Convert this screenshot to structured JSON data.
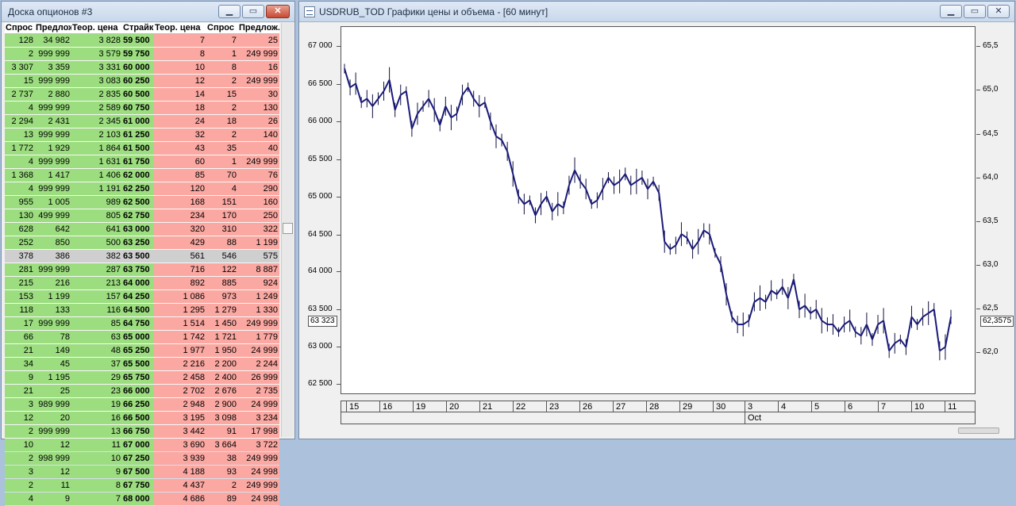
{
  "board": {
    "title": "Доска опционов #3",
    "headers": [
      "Спрос",
      "Предлож.",
      "Теор. цена",
      "Страйк",
      "Теор. цена",
      "Спрос",
      "Предлож."
    ],
    "rows": [
      [
        "128",
        "34 982",
        "3 828",
        "59 500",
        "7",
        "7",
        "25"
      ],
      [
        "2",
        "999 999",
        "3 579",
        "59 750",
        "8",
        "1",
        "249 999"
      ],
      [
        "3 307",
        "3 359",
        "3 331",
        "60 000",
        "10",
        "8",
        "16"
      ],
      [
        "15",
        "999 999",
        "3 083",
        "60 250",
        "12",
        "2",
        "249 999"
      ],
      [
        "2 737",
        "2 880",
        "2 835",
        "60 500",
        "14",
        "15",
        "30"
      ],
      [
        "4",
        "999 999",
        "2 589",
        "60 750",
        "18",
        "2",
        "130"
      ],
      [
        "2 294",
        "2 431",
        "2 345",
        "61 000",
        "24",
        "18",
        "26"
      ],
      [
        "13",
        "999 999",
        "2 103",
        "61 250",
        "32",
        "2",
        "140"
      ],
      [
        "1 772",
        "1 929",
        "1 864",
        "61 500",
        "43",
        "35",
        "40"
      ],
      [
        "4",
        "999 999",
        "1 631",
        "61 750",
        "60",
        "1",
        "249 999"
      ],
      [
        "1 368",
        "1 417",
        "1 406",
        "62 000",
        "85",
        "70",
        "76"
      ],
      [
        "4",
        "999 999",
        "1 191",
        "62 250",
        "120",
        "4",
        "290"
      ],
      [
        "955",
        "1 005",
        "989",
        "62 500",
        "168",
        "151",
        "160"
      ],
      [
        "130",
        "499 999",
        "805",
        "62 750",
        "234",
        "170",
        "250"
      ],
      [
        "628",
        "642",
        "641",
        "63 000",
        "320",
        "310",
        "322"
      ],
      [
        "252",
        "850",
        "500",
        "63 250",
        "429",
        "88",
        "1 199"
      ],
      [
        "378",
        "386",
        "382",
        "63 500",
        "561",
        "546",
        "575"
      ],
      [
        "281",
        "999 999",
        "287",
        "63 750",
        "716",
        "122",
        "8 887"
      ],
      [
        "215",
        "216",
        "213",
        "64 000",
        "892",
        "885",
        "924"
      ],
      [
        "153",
        "1 199",
        "157",
        "64 250",
        "1 086",
        "973",
        "1 249"
      ],
      [
        "118",
        "133",
        "116",
        "64 500",
        "1 295",
        "1 279",
        "1 330"
      ],
      [
        "17",
        "999 999",
        "85",
        "64 750",
        "1 514",
        "1 450",
        "249 999"
      ],
      [
        "66",
        "78",
        "63",
        "65 000",
        "1 742",
        "1 721",
        "1 779"
      ],
      [
        "21",
        "149",
        "48",
        "65 250",
        "1 977",
        "1 950",
        "24 999"
      ],
      [
        "34",
        "45",
        "37",
        "65 500",
        "2 216",
        "2 200",
        "2 244"
      ],
      [
        "9",
        "1 195",
        "29",
        "65 750",
        "2 458",
        "2 400",
        "26 999"
      ],
      [
        "21",
        "25",
        "23",
        "66 000",
        "2 702",
        "2 676",
        "2 735"
      ],
      [
        "3",
        "989 999",
        "19",
        "66 250",
        "2 948",
        "2 900",
        "24 999"
      ],
      [
        "12",
        "20",
        "16",
        "66 500",
        "3 195",
        "3 098",
        "3 234"
      ],
      [
        "2",
        "999 999",
        "13",
        "66 750",
        "3 442",
        "91",
        "17 998"
      ],
      [
        "10",
        "12",
        "11",
        "67 000",
        "3 690",
        "3 664",
        "3 722"
      ],
      [
        "2",
        "998 999",
        "10",
        "67 250",
        "3 939",
        "38",
        "249 999"
      ],
      [
        "3",
        "12",
        "9",
        "67 500",
        "4 188",
        "93",
        "24 998"
      ],
      [
        "2",
        "11",
        "8",
        "67 750",
        "4 437",
        "2",
        "249 999"
      ],
      [
        "4",
        "9",
        "7",
        "68 000",
        "4 686",
        "89",
        "24 998"
      ]
    ],
    "selected_index": 16
  },
  "chart": {
    "title": "USDRUB_TOD Графики цены и объема - [60 минут]",
    "left_ticks": [
      "67 000",
      "66 500",
      "66 000",
      "65 500",
      "65 000",
      "64 500",
      "64 000",
      "63 500",
      "63 000",
      "62 500"
    ],
    "right_ticks": [
      "65,5",
      "65,0",
      "64,5",
      "64,0",
      "63,5",
      "63,0",
      "62,5",
      "62,0"
    ],
    "current_left": "63 323",
    "current_right": "62,3575",
    "x_days": [
      "15",
      "16",
      "19",
      "20",
      "21",
      "22",
      "23",
      "26",
      "27",
      "28",
      "29",
      "30",
      "3",
      "4",
      "5",
      "6",
      "7",
      "10",
      "11"
    ],
    "x_month": "Oct"
  },
  "chart_data": {
    "type": "line",
    "ylim": [
      62300,
      67250
    ],
    "x": [
      "15",
      "16",
      "19",
      "20",
      "21",
      "22",
      "23",
      "26",
      "27",
      "28",
      "29",
      "30",
      "3",
      "4",
      "5",
      "6",
      "7",
      "10",
      "11"
    ],
    "series": [
      {
        "values": [
          66700,
          66450,
          66500,
          66250,
          66300,
          66200,
          66300,
          66400,
          66550,
          66150,
          66350,
          66400,
          65900,
          66100,
          66200,
          66300,
          66150,
          65950,
          66200,
          66050,
          66100,
          66350,
          66450,
          66300,
          66200,
          66250,
          66000,
          65800,
          65750,
          65600,
          65300,
          65000,
          64900,
          64950,
          64750,
          64900,
          65000,
          64800,
          64900,
          64850,
          65150,
          65350,
          65200,
          65100,
          64900,
          64950,
          65100,
          65250,
          65150,
          65200,
          65300,
          65150,
          65200,
          65250,
          65100,
          65200,
          65050,
          64400,
          64300,
          64350,
          64500,
          64450,
          64300,
          64400,
          64550,
          64500,
          64250,
          64100,
          63700,
          63400,
          63300,
          63300,
          63350,
          63600,
          63650,
          63600,
          63750,
          63700,
          63800,
          63650,
          63900,
          63500,
          63550,
          63450,
          63500,
          63350,
          63300,
          63300,
          63200,
          63300,
          63350,
          63200,
          63150,
          63300,
          63100,
          63300,
          63350,
          62950,
          63050,
          63100,
          63000,
          63400,
          63300,
          63400,
          63450,
          63500,
          62950,
          63000,
          63400
        ]
      }
    ]
  }
}
